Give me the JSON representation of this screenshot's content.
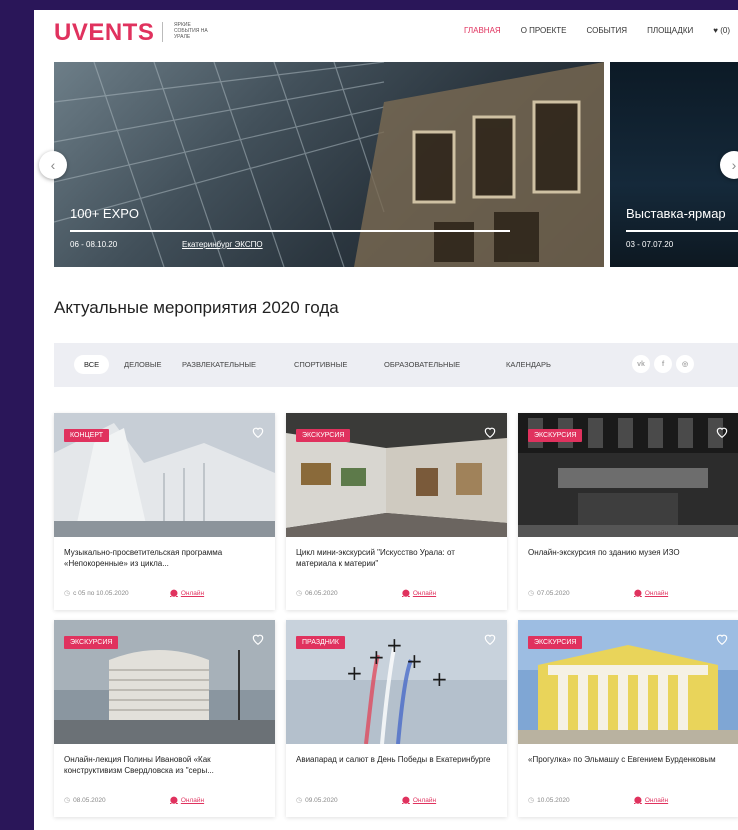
{
  "header": {
    "logo": "UVENTS",
    "tagline": "яркие события на урале",
    "nav": {
      "home": "ГЛАВНАЯ",
      "about": "О ПРОЕКТЕ",
      "events": "СОБЫТИЯ",
      "venues": "ПЛОЩАДКИ",
      "favorites_count": "(0)"
    }
  },
  "slider": {
    "slides": [
      {
        "title": "100+ EXPO",
        "date": "06 - 08.10.20",
        "place": "Екатеринбург ЭКСПО"
      },
      {
        "title": "Выставка-ярмар",
        "date": "03 - 07.07.20"
      }
    ]
  },
  "section": {
    "title": "Актуальные мероприятия 2020 года",
    "filters": [
      "ВСЕ",
      "ДЕЛОВЫЕ",
      "РАЗВЛЕКАТЕЛЬНЫЕ",
      "СПОРТИВНЫЕ",
      "ОБРАЗОВАТЕЛЬНЫЕ",
      "КАЛЕНДАРЬ"
    ],
    "social": [
      "vk",
      "f",
      "◎"
    ]
  },
  "cards": [
    {
      "badge": "КОНЦЕРТ",
      "title": "Музыкально-просветительская программа «Непокоренные» из цикла...",
      "date": "с 05 по 10.05.2020",
      "location": "Онлайн"
    },
    {
      "badge": "ЭКСКУРСИЯ",
      "title": "Цикл мини-экскурсий \"Искусство Урала: от материала к материи\"",
      "date": "06.05.2020",
      "location": "Онлайн"
    },
    {
      "badge": "ЭКСКУРСИЯ",
      "title": "Онлайн-экскурсия по зданию музея ИЗО",
      "date": "07.05.2020",
      "location": "Онлайн"
    },
    {
      "badge": "ЭКСКУРСИЯ",
      "title": "Онлайн-лекция Полины Ивановой «Как конструктивизм Свердловска из \"серы...",
      "date": "08.05.2020",
      "location": "Онлайн"
    },
    {
      "badge": "ПРАЗДНИК",
      "title": "Авиапарад и салют в День Победы в Екатеринбурге",
      "date": "09.05.2020",
      "location": "Онлайн"
    },
    {
      "badge": "ЭКСКУРСИЯ",
      "title": "«Прогулка» по Эльмашу с Евгением Бурденковым",
      "date": "10.05.2020",
      "location": "Онлайн"
    }
  ],
  "colors": {
    "accent": "#e0325e",
    "background": "#2a1659",
    "filter_bar": "#edeef3"
  }
}
